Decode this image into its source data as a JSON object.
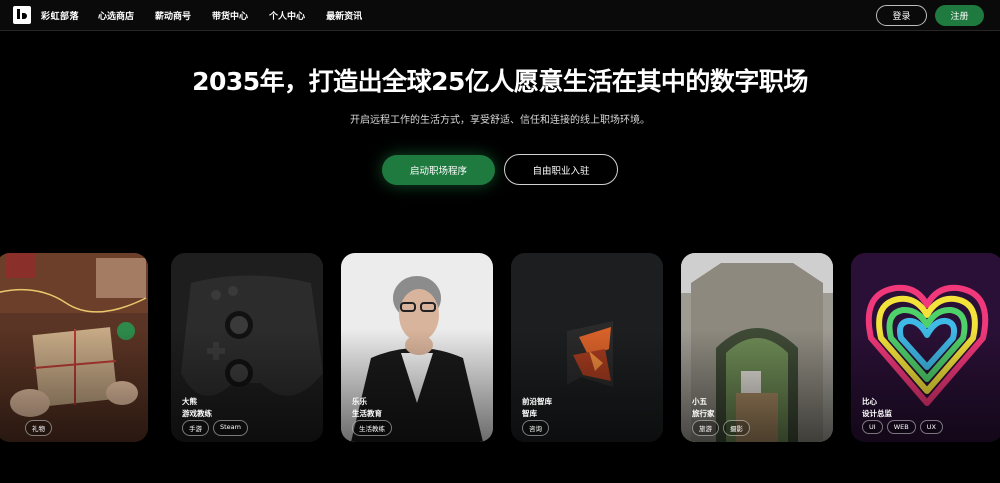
{
  "nav": {
    "brand": "彩虹部落",
    "links": [
      "心选商店",
      "薪动商号",
      "带货中心",
      "个人中心",
      "最新资讯"
    ],
    "login": "登录",
    "register": "注册"
  },
  "hero": {
    "title": "2035年，打造出全球25亿人愿意生活在其中的数字职场",
    "subtitle": "开启远程工作的生活方式，享受舒适、信任和连接的线上职场环境。",
    "cta_primary": "启动职场程序",
    "cta_secondary": "自由职业入驻"
  },
  "cards": [
    {
      "name": "",
      "role": "",
      "tags": [
        "",
        "礼物"
      ]
    },
    {
      "name": "大熊",
      "role": "游戏教练",
      "tags": [
        "手游",
        "Steam"
      ]
    },
    {
      "name": "乐乐",
      "role": "生活教育",
      "tags": [
        "生活教练"
      ]
    },
    {
      "name": "前沿智库",
      "role": "智库",
      "tags": [
        "咨询"
      ]
    },
    {
      "name": "小五",
      "role": "旅行家",
      "tags": [
        "旅游",
        "摄影"
      ]
    },
    {
      "name": "比心",
      "role": "设计总监",
      "tags": [
        "UI",
        "WEB",
        "UX"
      ]
    }
  ],
  "colors": {
    "accent": "#1f7a3f",
    "background": "#000000"
  }
}
